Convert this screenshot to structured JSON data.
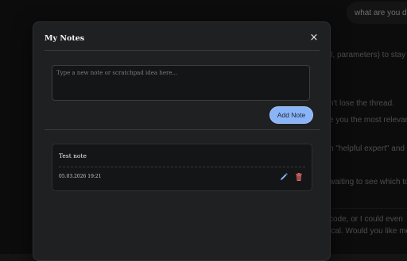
{
  "background": {
    "user_bubble": "what are you do",
    "lines": [
      "ll, parameters) to stay",
      "n't lose the thread.",
      "e you the most relevant",
      "n \"helpful expert\" and",
      "waiting to see which too",
      "code, or I could even",
      "ical. Would you like me"
    ]
  },
  "modal": {
    "title": "My Notes",
    "close_label": "×",
    "input_placeholder": "Type a new note or scratchpad idea here...",
    "input_value": "",
    "add_button_label": "Add Note"
  },
  "notes": [
    {
      "title": "Test note",
      "timestamp": "05.03.2026 19:21",
      "edit_icon": "pencil-icon",
      "delete_icon": "trash-icon"
    }
  ],
  "colors": {
    "accent": "#8ab4f8",
    "delete": "#e06666",
    "edit": "#8ab4f8",
    "modal_bg": "#1f2021"
  }
}
